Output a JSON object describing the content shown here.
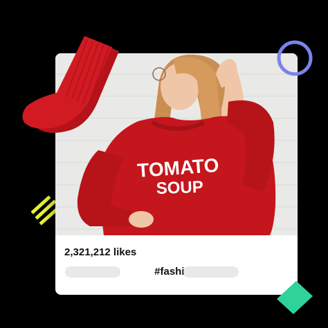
{
  "post": {
    "likes": "2,321,212 likes",
    "hashtag": "#fashion"
  },
  "photo": {
    "shirt_text_line1": "TOMATO",
    "shirt_text_line2": "SOUP"
  },
  "icons": {
    "socks": "red-socks-icon",
    "circle": "circle-outline-icon",
    "stripes": "yellow-stripes-icon",
    "diamond": "green-diamond-icon"
  },
  "colors": {
    "background": "#000000",
    "sweater": "#c4161c",
    "circle": "#7b83eb",
    "stripes": "#e8f235",
    "diamond": "#2fd39a"
  }
}
